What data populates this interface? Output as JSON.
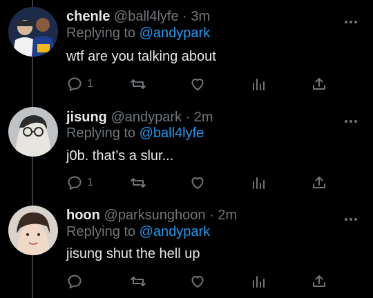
{
  "tweets": [
    {
      "name": "chenle",
      "handle": "@ball4lyfe",
      "time": "· 3m",
      "replying_prefix": "Replying to ",
      "replying_to": "@andypark",
      "text": "wtf are you talking about",
      "reply_count": "1"
    },
    {
      "name": "jisung",
      "handle": "@andypark",
      "time": "· 2m",
      "replying_prefix": "Replying to ",
      "replying_to": "@ball4lyfe",
      "text": "j0b. that’s a slur...",
      "reply_count": "1"
    },
    {
      "name": "hoon",
      "handle": "@parksunghoon",
      "time": "· 2m",
      "replying_prefix": "Replying to ",
      "replying_to": "@andypark",
      "text": "jisung shut the hell up",
      "reply_count": ""
    }
  ],
  "colors": {
    "background": "#000000",
    "text": "#e7e9ea",
    "muted": "#71767b",
    "accent": "#1d9bf0"
  },
  "icons": [
    "reply-icon",
    "retweet-icon",
    "like-icon",
    "analytics-icon",
    "share-icon",
    "more-icon"
  ]
}
